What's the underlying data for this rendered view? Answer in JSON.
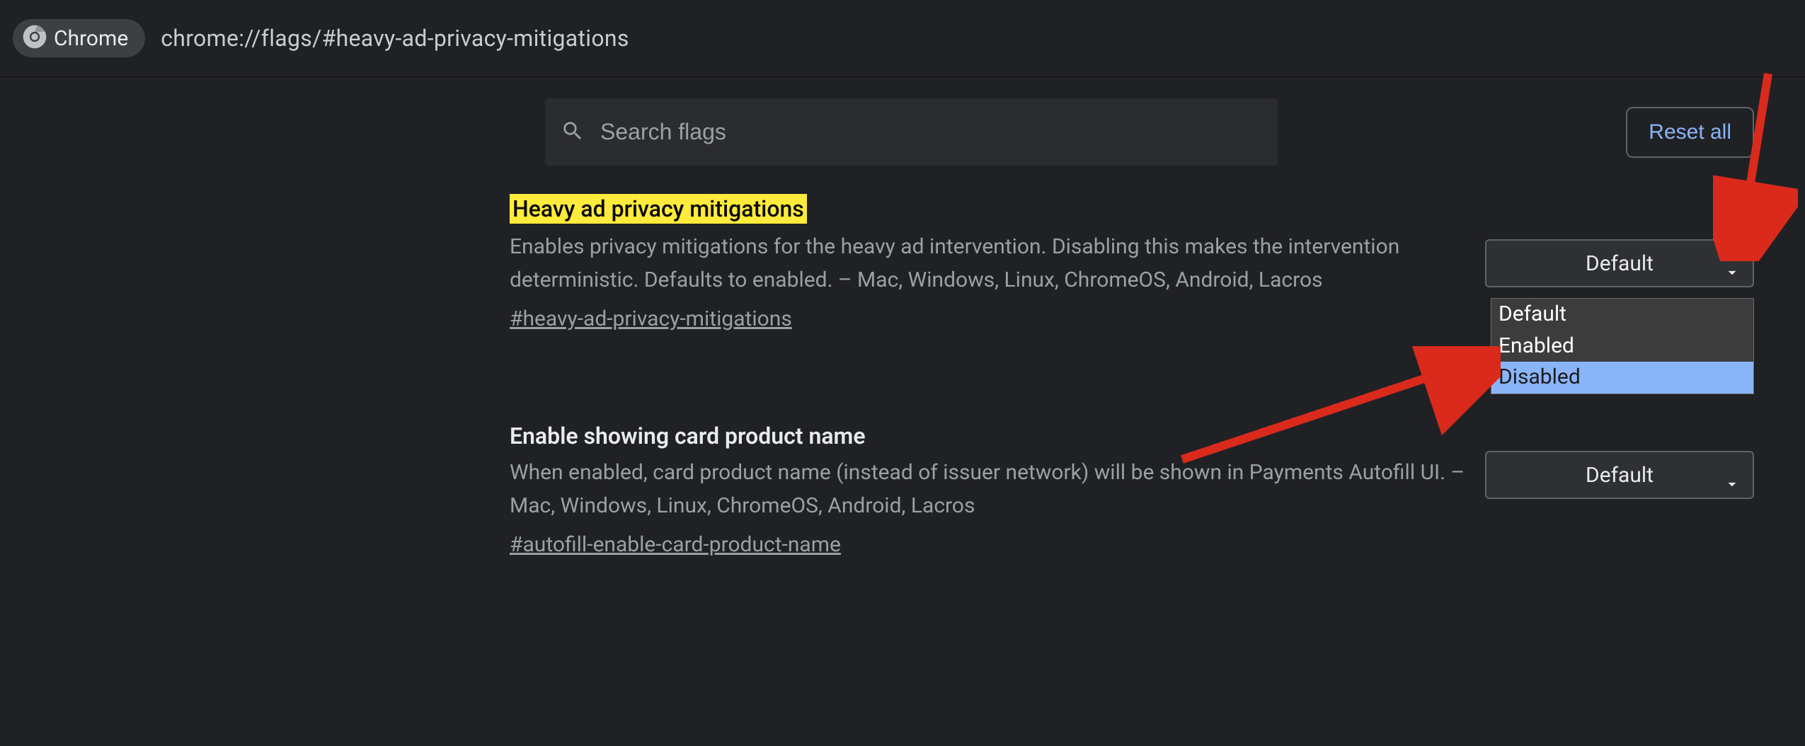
{
  "omnibox": {
    "chip_label": "Chrome",
    "url": "chrome://flags/#heavy-ad-privacy-mitigations"
  },
  "search": {
    "placeholder": "Search flags",
    "reset_label": "Reset all"
  },
  "flags": [
    {
      "title": "Heavy ad privacy mitigations",
      "highlighted": true,
      "description": "Enables privacy mitigations for the heavy ad intervention. Disabling this makes the intervention deterministic. Defaults to enabled. – Mac, Windows, Linux, ChromeOS, Android, Lacros",
      "anchor": "#heavy-ad-privacy-mitigations",
      "select_value": "Default"
    },
    {
      "title": "Enable showing card product name",
      "highlighted": false,
      "description": "When enabled, card product name (instead of issuer network) will be shown in Payments Autofill UI. – Mac, Windows, Linux, ChromeOS, Android, Lacros",
      "anchor": "#autofill-enable-card-product-name",
      "select_value": "Default"
    }
  ],
  "dropdown": {
    "options": [
      "Default",
      "Enabled",
      "Disabled"
    ],
    "hovered_index": 2
  },
  "annotation_color": "#d92a1c"
}
